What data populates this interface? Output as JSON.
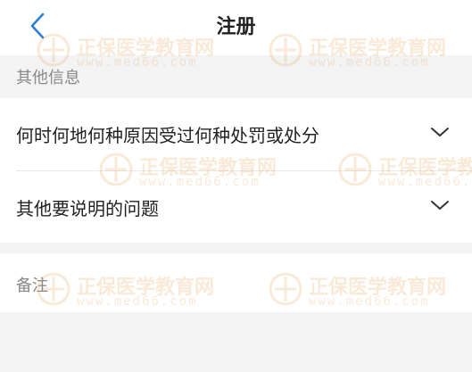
{
  "header": {
    "title": "注册",
    "back_icon": "chevron-left-icon"
  },
  "sections": {
    "other_info": {
      "heading": "其他信息",
      "rows": [
        {
          "label": "何时何地何种原因受过何种处罚或处分",
          "icon": "chevron-down-icon"
        },
        {
          "label": "其他要说明的问题",
          "icon": "chevron-down-icon"
        }
      ]
    },
    "remarks": {
      "heading": "备注",
      "value": ""
    }
  },
  "watermark": {
    "name": "正保医学教育网",
    "url": "www.med66.com",
    "color": "#e08a2a"
  },
  "colors": {
    "accent": "#2f7fd1",
    "section_bg": "#f3f3f4",
    "text": "#222222",
    "muted": "#888888"
  }
}
